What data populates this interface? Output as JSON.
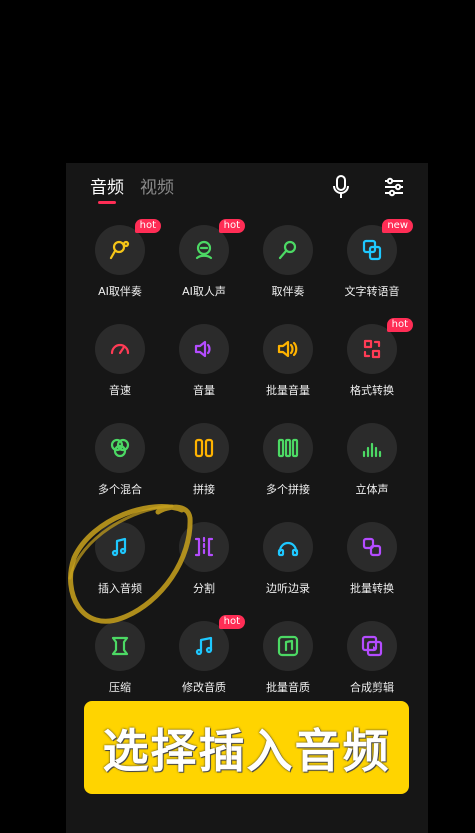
{
  "tabs": [
    {
      "label": "音频",
      "active": true
    },
    {
      "label": "视频",
      "active": false
    }
  ],
  "header_icons": [
    "microphone-icon",
    "sliders-icon"
  ],
  "tools": [
    {
      "label": "AI取伴奏",
      "icon": "ai-accompaniment-icon",
      "badge": "hot",
      "color": "#f5c518"
    },
    {
      "label": "AI取人声",
      "icon": "ai-vocal-icon",
      "badge": "hot",
      "color": "#4cd964"
    },
    {
      "label": "取伴奏",
      "icon": "accompaniment-icon",
      "badge": "",
      "color": "#4cd964"
    },
    {
      "label": "文字转语音",
      "icon": "text-to-speech-icon",
      "badge": "new",
      "color": "#1ec8ff"
    },
    {
      "label": "音速",
      "icon": "speedometer-icon",
      "badge": "",
      "color": "#ff3b55"
    },
    {
      "label": "音量",
      "icon": "volume-icon",
      "badge": "",
      "color": "#b44cff"
    },
    {
      "label": "批量音量",
      "icon": "batch-volume-icon",
      "badge": "",
      "color": "#ffb300"
    },
    {
      "label": "格式转换",
      "icon": "format-convert-icon",
      "badge": "hot",
      "color": "#ff3b55"
    },
    {
      "label": "多个混合",
      "icon": "mix-icon",
      "badge": "",
      "color": "#4cd964"
    },
    {
      "label": "拼接",
      "icon": "join-icon",
      "badge": "",
      "color": "#ffb300"
    },
    {
      "label": "多个拼接",
      "icon": "multi-join-icon",
      "badge": "",
      "color": "#4cd964"
    },
    {
      "label": "立体声",
      "icon": "stereo-icon",
      "badge": "",
      "color": "#4cd964"
    },
    {
      "label": "插入音频",
      "icon": "insert-audio-icon",
      "badge": "",
      "color": "#1ec8ff"
    },
    {
      "label": "分割",
      "icon": "split-icon",
      "badge": "",
      "color": "#b44cff"
    },
    {
      "label": "边听边录",
      "icon": "record-listen-icon",
      "badge": "",
      "color": "#1ec8ff"
    },
    {
      "label": "批量转换",
      "icon": "batch-convert-icon",
      "badge": "",
      "color": "#b44cff"
    },
    {
      "label": "压缩",
      "icon": "compress-icon",
      "badge": "",
      "color": "#4cd964"
    },
    {
      "label": "修改音质",
      "icon": "quality-icon",
      "badge": "hot",
      "color": "#1ec8ff"
    },
    {
      "label": "批量音质",
      "icon": "batch-quality-icon",
      "badge": "",
      "color": "#4cd964"
    },
    {
      "label": "合成剪辑",
      "icon": "compose-edit-icon",
      "badge": "",
      "color": "#b44cff"
    }
  ],
  "banner": {
    "text": "选择插入音频"
  },
  "colors": {
    "accent": "#ff2d55",
    "highlight": "#ffd400"
  }
}
